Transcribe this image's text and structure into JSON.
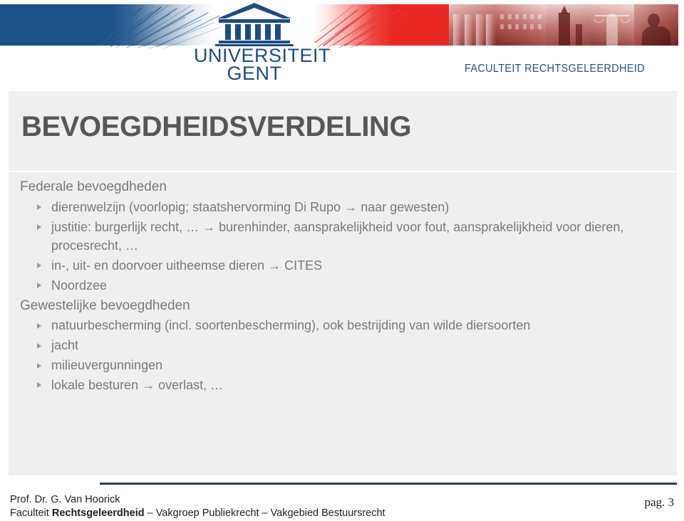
{
  "header": {
    "university_line1": "UNIVERSITEIT",
    "university_line2": "GENT",
    "faculty_label": "FACULTEIT RECHTSGELEERDHEID",
    "logo_icon": "classical-temple-icon",
    "colors": {
      "blue": "#1b5287",
      "red": "#e92823",
      "navy_text": "#23548c"
    }
  },
  "slide": {
    "title": "BEVOEGDHEIDSVERDELING",
    "sections": [
      {
        "heading": "Federale bevoegdheden",
        "bullets": [
          "dierenwelzijn (voorlopig; staatshervorming Di Rupo → naar gewesten)",
          "justitie: burgerlijk recht, … → burenhinder, aansprakelijkheid voor fout, aansprakelijkheid voor dieren, procesrecht, …",
          "in-, uit- en doorvoer uitheemse dieren → CITES",
          "Noordzee"
        ]
      },
      {
        "heading": "Gewestelijke bevoegdheden",
        "bullets": [
          "natuurbescherming (incl. soortenbescherming), ook bestrijding van wilde diersoorten",
          "jacht",
          "milieuvergunningen",
          "lokale besturen → overlast, …"
        ]
      }
    ],
    "colors": {
      "background": "#efefef",
      "title_text": "#575757",
      "body_text": "#7a7a7a"
    }
  },
  "footer": {
    "author": "Prof. Dr. G. Van Hoorick",
    "department_prefix": "Faculteit ",
    "department_bold": "Rechtsgeleerdheid",
    "department_suffix": " – Vakgroep Publiekrecht – Vakgebied Bestuursrecht",
    "page_label": "pag. 3",
    "rule_color": "#2b3a73"
  }
}
